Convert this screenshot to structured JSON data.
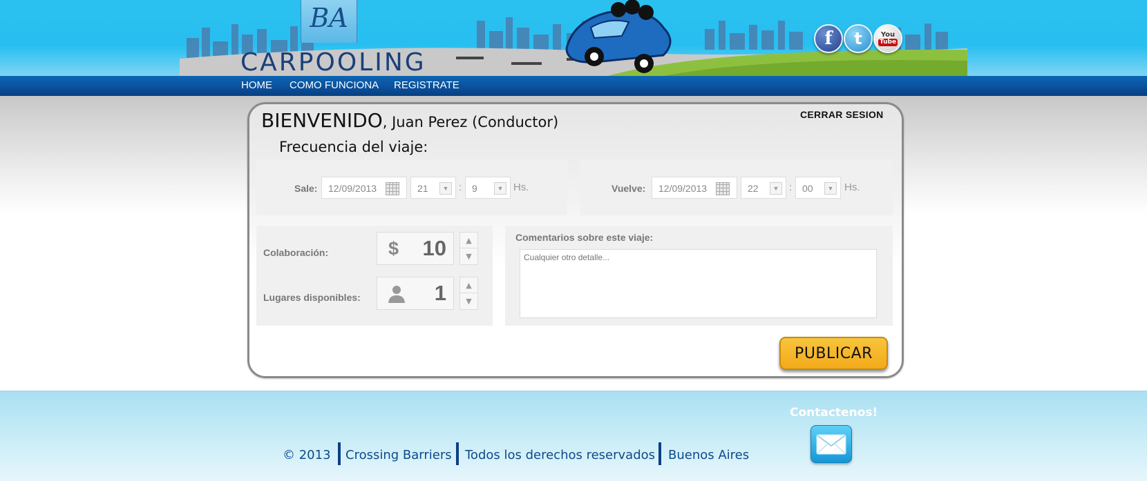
{
  "brand": {
    "logo_initials": "BA",
    "logo_name": "CARPOOLING"
  },
  "social": {
    "facebook": "f",
    "twitter": "t",
    "youtube_top": "You",
    "youtube_bottom": "Tube"
  },
  "nav": {
    "items": [
      "HOME",
      "COMO FUNCIONA",
      "REGISTRATE"
    ]
  },
  "welcome": {
    "title": "BIENVENIDO",
    "user": ", Juan Perez (Conductor)"
  },
  "logout_label": "CERRAR SESION",
  "frequency_title": "Frecuencia del viaje:",
  "departure": {
    "label": "Sale:",
    "date": "12/09/2013",
    "hour": "21",
    "minute": "9",
    "unit": "Hs."
  },
  "return": {
    "label": "Vuelve:",
    "date": "12/09/2013",
    "hour": "22",
    "minute": "00",
    "unit": "Hs."
  },
  "time_separator": ":",
  "collaboration": {
    "label": "Colaboración:",
    "currency": "$",
    "value": "10"
  },
  "seats": {
    "label": "Lugares disponibles:",
    "value": "1"
  },
  "comments": {
    "label": "Comentarios sobre este viaje:",
    "placeholder": "Cualquier otro detalle..."
  },
  "publish_label": "PUBLICAR",
  "footer": {
    "copyright": "© 2013",
    "company": "Crossing Barriers",
    "rights": "Todos los derechos reservados",
    "city": "Buenos Aires",
    "contact_title": "Contactenos!"
  },
  "colors": {
    "nav_blue": "#0a4f9a",
    "sky": "#27bff0",
    "publish_yellow": "#f3aa1a",
    "footer_text": "#0d4a8a"
  },
  "icons": [
    "calendar-icon",
    "dropdown-arrow-icon",
    "person-icon",
    "stepper-up-icon",
    "stepper-down-icon",
    "mail-icon",
    "facebook-icon",
    "twitter-icon",
    "youtube-icon"
  ]
}
